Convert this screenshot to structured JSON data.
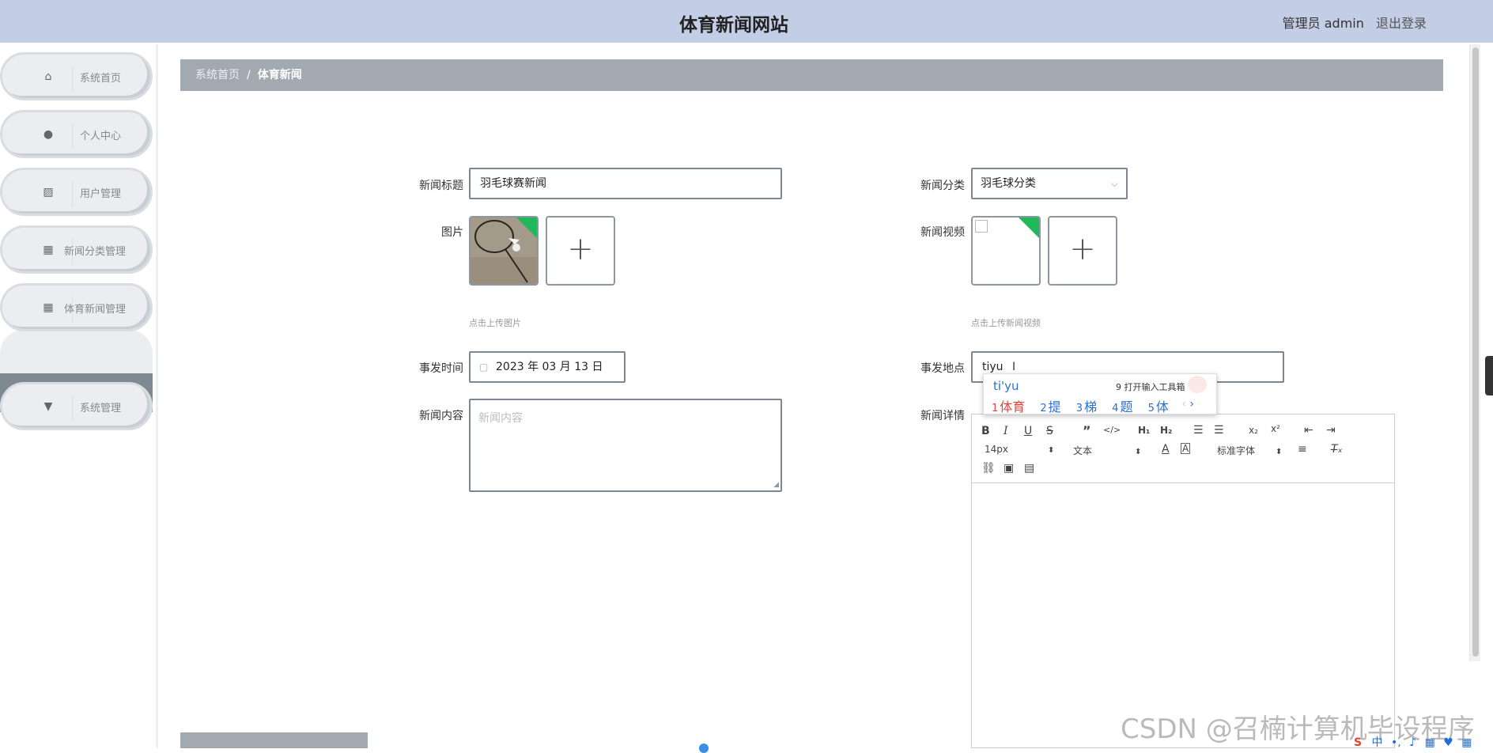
{
  "header": {
    "title": "体育新闻网站",
    "user_label": "管理员 admin",
    "logout_label": "退出登录"
  },
  "sidebar": {
    "items": [
      {
        "label": "系统首页",
        "icon": "home-icon"
      },
      {
        "label": "个人中心",
        "icon": "user-icon"
      },
      {
        "label": "用户管理",
        "icon": "chart-icon"
      },
      {
        "label": "新闻分类管理",
        "icon": "grid-icon"
      },
      {
        "label": "体育新闻管理",
        "icon": "grid-icon"
      },
      {
        "label": "系统管理",
        "icon": "pin-icon"
      }
    ],
    "active_sub": "体育新闻"
  },
  "breadcrumb": {
    "home": "系统首页",
    "sep": "/",
    "current": "体育新闻"
  },
  "form": {
    "title_label": "新闻标题",
    "title_value": "羽毛球赛新闻",
    "category_label": "新闻分类",
    "category_value": "羽毛球分类",
    "image_label": "图片",
    "image_tip": "点击上传图片",
    "video_label": "新闻视频",
    "video_tip": "点击上传新闻视频",
    "time_label": "事发时间",
    "time_value": "2023 年 03 月 13 日",
    "place_label": "事发地点",
    "place_value": "tiyu",
    "content_label": "新闻内容",
    "content_placeholder": "新闻内容",
    "detail_label": "新闻详情",
    "add_symbol": "+"
  },
  "ime": {
    "pinyin": "ti'yu",
    "tools": "9 打开输入工具箱",
    "candidates": [
      {
        "num": "1",
        "text": "体育"
      },
      {
        "num": "2",
        "text": "提"
      },
      {
        "num": "3",
        "text": "梯"
      },
      {
        "num": "4",
        "text": "题"
      },
      {
        "num": "5",
        "text": "体"
      }
    ]
  },
  "editor": {
    "font_size": "14px",
    "text_type": "文本",
    "font_family": "标准字体"
  },
  "watermark": "CSDN @召楠计算机毕设程序",
  "tray": {
    "sogou": "S",
    "lang": "中"
  }
}
